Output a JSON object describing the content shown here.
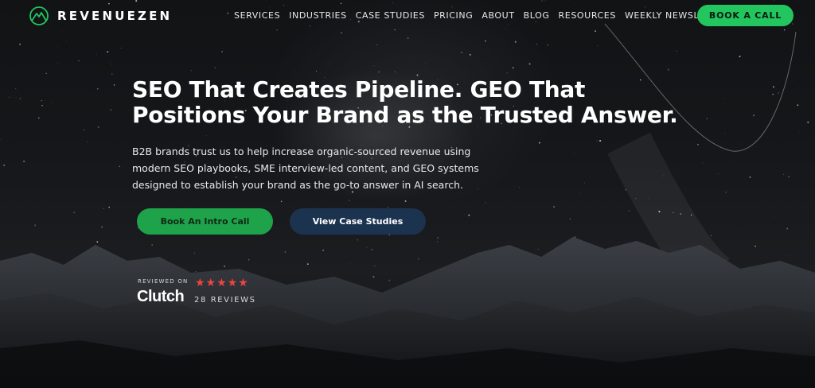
{
  "header": {
    "brand": "REVENUEZEN",
    "nav": [
      "SERVICES",
      "INDUSTRIES",
      "CASE STUDIES",
      "PRICING",
      "ABOUT",
      "BLOG",
      "RESOURCES",
      "WEEKLY NEWSLETTER"
    ],
    "cta": "BOOK A CALL",
    "logo_icon": "mountain-logo-icon"
  },
  "hero": {
    "headline": "SEO That Creates Pipeline. GEO That Positions Your Brand as the Trusted Answer.",
    "subcopy": "B2B brands trust us to help increase organic-sourced revenue using modern SEO playbooks, SME interview-led content, and GEO systems designed to establish your brand as the go-to answer in AI search.",
    "primary_button": "Book An Intro Call",
    "secondary_button": "View Case Studies"
  },
  "clutch": {
    "reviewed_on": "REVIEWED ON",
    "brand": "Clutch",
    "rating": 5,
    "stars": "★★★★★",
    "reviews": "28 REVIEWS"
  },
  "colors": {
    "accent_green": "#22c55e",
    "secondary_button": "#1c3350",
    "star_red": "#ef4444"
  }
}
